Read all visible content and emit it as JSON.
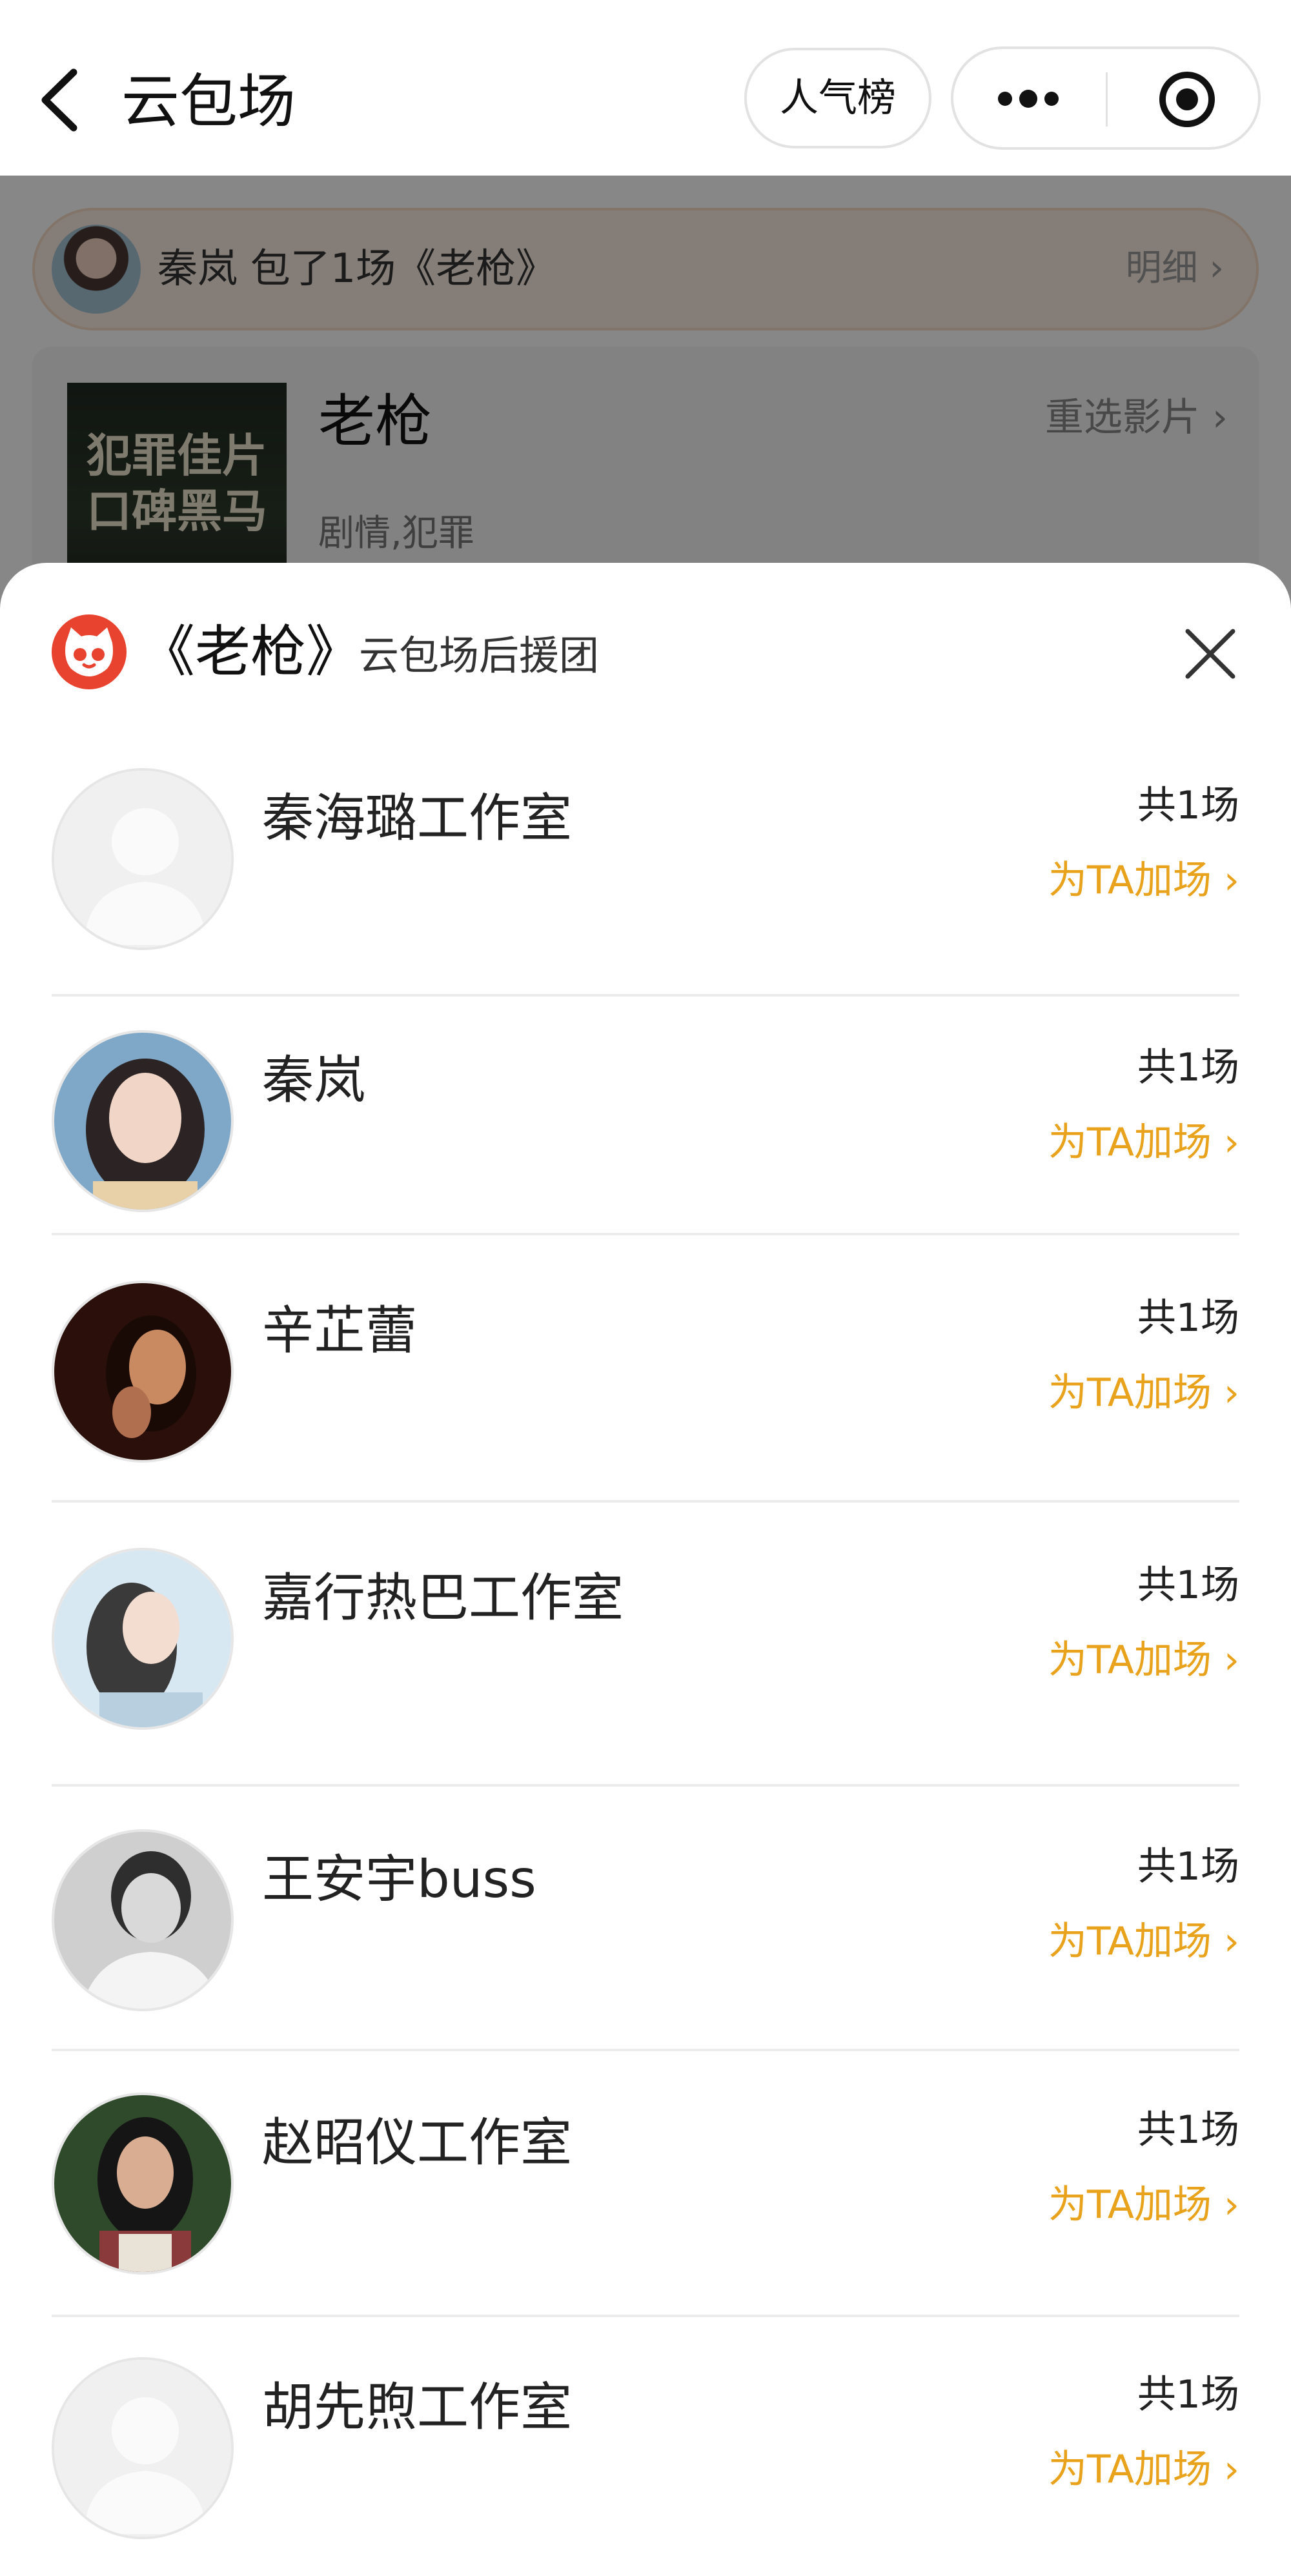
{
  "navbar": {
    "title": "云包场",
    "rank_label": "人气榜",
    "icons": [
      "back-arrow-icon",
      "more-dots-icon",
      "target-icon"
    ]
  },
  "banner": {
    "text": "秦岚 包了1场《老枪》",
    "detail_label": "明细 ›"
  },
  "movie": {
    "poster_text": "犯罪佳片 口碑黑马",
    "title": "老枪",
    "genre": "剧情,犯罪",
    "reselect_label": "重选影片 ›"
  },
  "sheet": {
    "movie": "《老枪》",
    "subtitle": "云包场后援团",
    "logo_icon": "cat-eye-logo-icon",
    "close_icon": "close-icon",
    "supporters": [
      {
        "name": "秦海璐工作室",
        "count": "共1场",
        "action": "为TA加场 ›",
        "avatar": "default"
      },
      {
        "name": "秦岚",
        "count": "共1场",
        "action": "为TA加场 ›",
        "avatar": "photo"
      },
      {
        "name": "辛芷蕾",
        "count": "共1场",
        "action": "为TA加场 ›",
        "avatar": "photo"
      },
      {
        "name": "嘉行热巴工作室",
        "count": "共1场",
        "action": "为TA加场 ›",
        "avatar": "photo"
      },
      {
        "name": "王安宇buss",
        "count": "共1场",
        "action": "为TA加场 ›",
        "avatar": "photo"
      },
      {
        "name": "赵昭仪工作室",
        "count": "共1场",
        "action": "为TA加场 ›",
        "avatar": "photo"
      },
      {
        "name": "胡先煦工作室",
        "count": "共1场",
        "action": "为TA加场 ›",
        "avatar": "default"
      }
    ]
  },
  "colors": {
    "accent_orange": "#e8a21b",
    "logo_red": "#e8432f",
    "banner_bg": "#fbeee2"
  }
}
